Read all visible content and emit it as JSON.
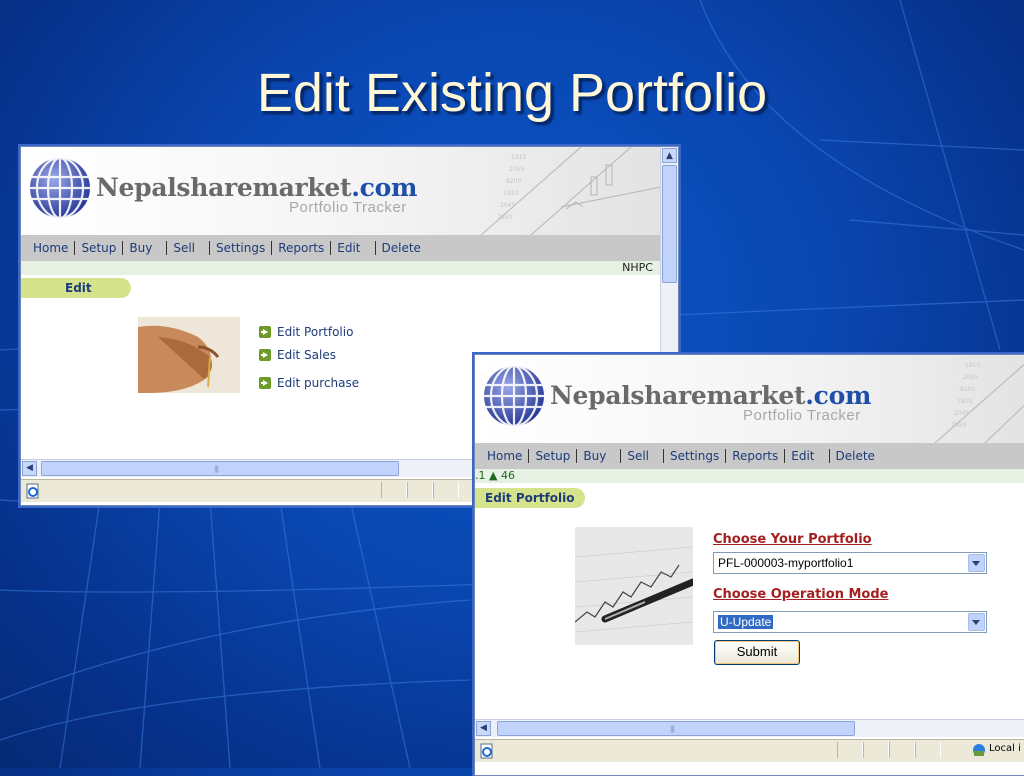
{
  "slide": {
    "title": "Edit Existing Portfolio"
  },
  "brand": {
    "name": "Nepalsharemarket",
    "tld": ".com",
    "subtitle": "Portfolio Tracker"
  },
  "nav": [
    "Home",
    "Setup",
    "Buy",
    "Sell",
    "Settings",
    "Reports",
    "Edit",
    "Delete"
  ],
  "window1": {
    "ticker": "NHPC",
    "section_tab": "Edit",
    "menu": [
      "Edit Portfolio",
      "Edit Sales",
      "Edit purchase"
    ]
  },
  "window2": {
    "ticker": ".1 ▲ 46",
    "section_tab": "Edit Portfolio",
    "portfolio_label": "Choose Your Portfolio",
    "portfolio_value": "PFL-000003-myportfolio1",
    "mode_label": "Choose Operation Mode",
    "mode_value": "U-Update",
    "submit_label": "Submit",
    "status_zone": "Local i"
  },
  "colors": {
    "nav_text": "#1e3c78",
    "form_label": "#a42020",
    "section_tab": "#d4e38c",
    "slide_bg": "#0a46b0"
  },
  "icons": [
    "globe-logo-icon",
    "arrow-right-icon",
    "scroll-up-icon",
    "scroll-left-icon",
    "ie-page-icon",
    "local-intranet-icon"
  ]
}
